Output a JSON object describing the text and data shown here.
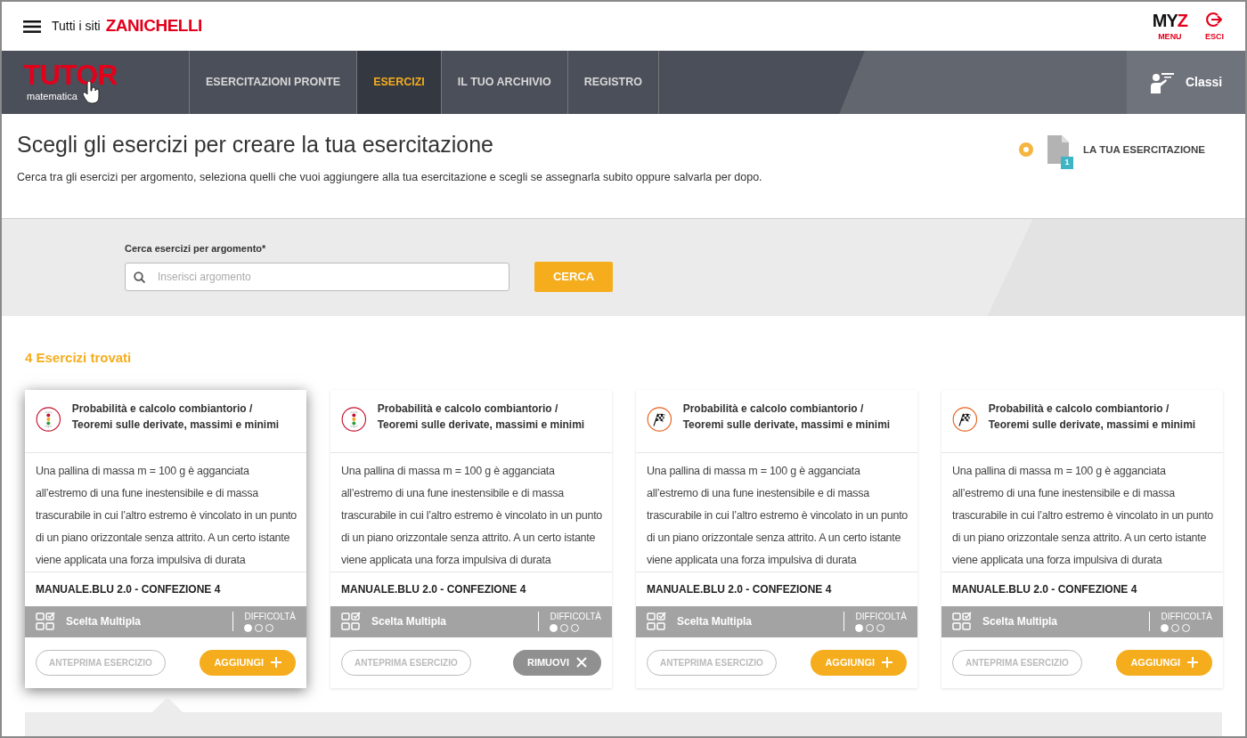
{
  "topbar": {
    "sites_label": "Tutti i siti",
    "brand": "ZANICHELLI",
    "myz": {
      "dark": "MY",
      "red": "Z",
      "label": "MENU"
    },
    "logout": {
      "label": "ESCI"
    }
  },
  "nav": {
    "logo": {
      "title": "TUTOR",
      "subtitle": "matematica"
    },
    "items": [
      {
        "label": "ESERCITAZIONI PRONTE",
        "selected": false
      },
      {
        "label": "ESERCIZI",
        "selected": true
      },
      {
        "label": "IL TUO ARCHIVIO",
        "selected": false
      },
      {
        "label": "REGISTRO",
        "selected": false
      }
    ],
    "classes_button": "Classi"
  },
  "intro": {
    "title": "Scegli gli esercizi per creare la tua esercitazione",
    "description": "Cerca tra gli esercizi per argomento, seleziona quelli che vuoi aggiungere alla tua esercitazione e scegli se assegnarla subito oppure salvarla per dopo.",
    "worksheet": {
      "count": "1",
      "label": "LA TUA ESERCITAZIONE"
    }
  },
  "search": {
    "label": "Cerca esercizi per argomento*",
    "placeholder": "Inserisci argomento",
    "button": "CERCA"
  },
  "results": {
    "heading": "4 Esercizi trovati",
    "cards": [
      {
        "selected": true,
        "kind": "traffic-light",
        "title": "Probabilità e calcolo combiantorio / Teoremi sulle derivate, massimi e minimi",
        "text": "Una pallina di massa m = 100 g è agganciata all’estremo di una fune inestensibile e di massa trascurabile in cui l’altro estremo è vincolato in un punto di un piano orizzontale senza attrito. A un certo istante viene applicata una forza impulsiva di durata",
        "book": "MANUALE.BLU 2.0 - CONFEZIONE 4",
        "type": "Scelta Multipla",
        "difficulty_label": "DIFFICOLTÀ",
        "stars": 1,
        "preview": "ANTEPRIMA ESERCIZIO",
        "action": {
          "kind": "add",
          "label": "AGGIUNGI"
        }
      },
      {
        "selected": false,
        "kind": "traffic-light",
        "title": "Probabilità e calcolo combiantorio / Teoremi sulle derivate, massimi e minimi",
        "text": "Una pallina di massa m = 100 g è agganciata all’estremo di una fune inestensibile e di massa trascurabile in cui l’altro estremo è vincolato in un punto di un piano orizzontale senza attrito. A un certo istante viene applicata una forza impulsiva di durata",
        "book": "MANUALE.BLU 2.0 - CONFEZIONE 4",
        "type": "Scelta Multipla",
        "difficulty_label": "DIFFICOLTÀ",
        "stars": 1,
        "preview": "ANTEPRIMA ESERCIZIO",
        "action": {
          "kind": "remove",
          "label": "RIMUOVI"
        }
      },
      {
        "selected": false,
        "kind": "flag",
        "title": "Probabilità e calcolo combiantorio / Teoremi sulle derivate, massimi e minimi",
        "text": "Una pallina di massa m = 100 g è agganciata all’estremo di una fune inestensibile e di massa trascurabile in cui l’altro estremo è vincolato in un punto di un piano orizzontale senza attrito. A un certo istante viene applicata una forza impulsiva di durata",
        "book": "MANUALE.BLU 2.0 - CONFEZIONE 4",
        "type": "Scelta Multipla",
        "difficulty_label": "DIFFICOLTÀ",
        "stars": 1,
        "preview": "ANTEPRIMA ESERCIZIO",
        "action": {
          "kind": "add",
          "label": "AGGIUNGI"
        }
      },
      {
        "selected": false,
        "kind": "flag",
        "title": "Probabilità e calcolo combiantorio / Teoremi sulle derivate, massimi e minimi",
        "text": "Una pallina di massa m = 100 g è agganciata all’estremo di una fune inestensibile e di massa trascurabile in cui l’altro estremo è vincolato in un punto di un piano orizzontale senza attrito. A un certo istante viene applicata una forza impulsiva di durata",
        "book": "MANUALE.BLU 2.0 - CONFEZIONE 4",
        "type": "Scelta Multipla",
        "difficulty_label": "DIFFICOLTÀ",
        "stars": 1,
        "preview": "ANTEPRIMA ESERCIZIO",
        "action": {
          "kind": "add",
          "label": "AGGIUNGI"
        }
      }
    ]
  }
}
